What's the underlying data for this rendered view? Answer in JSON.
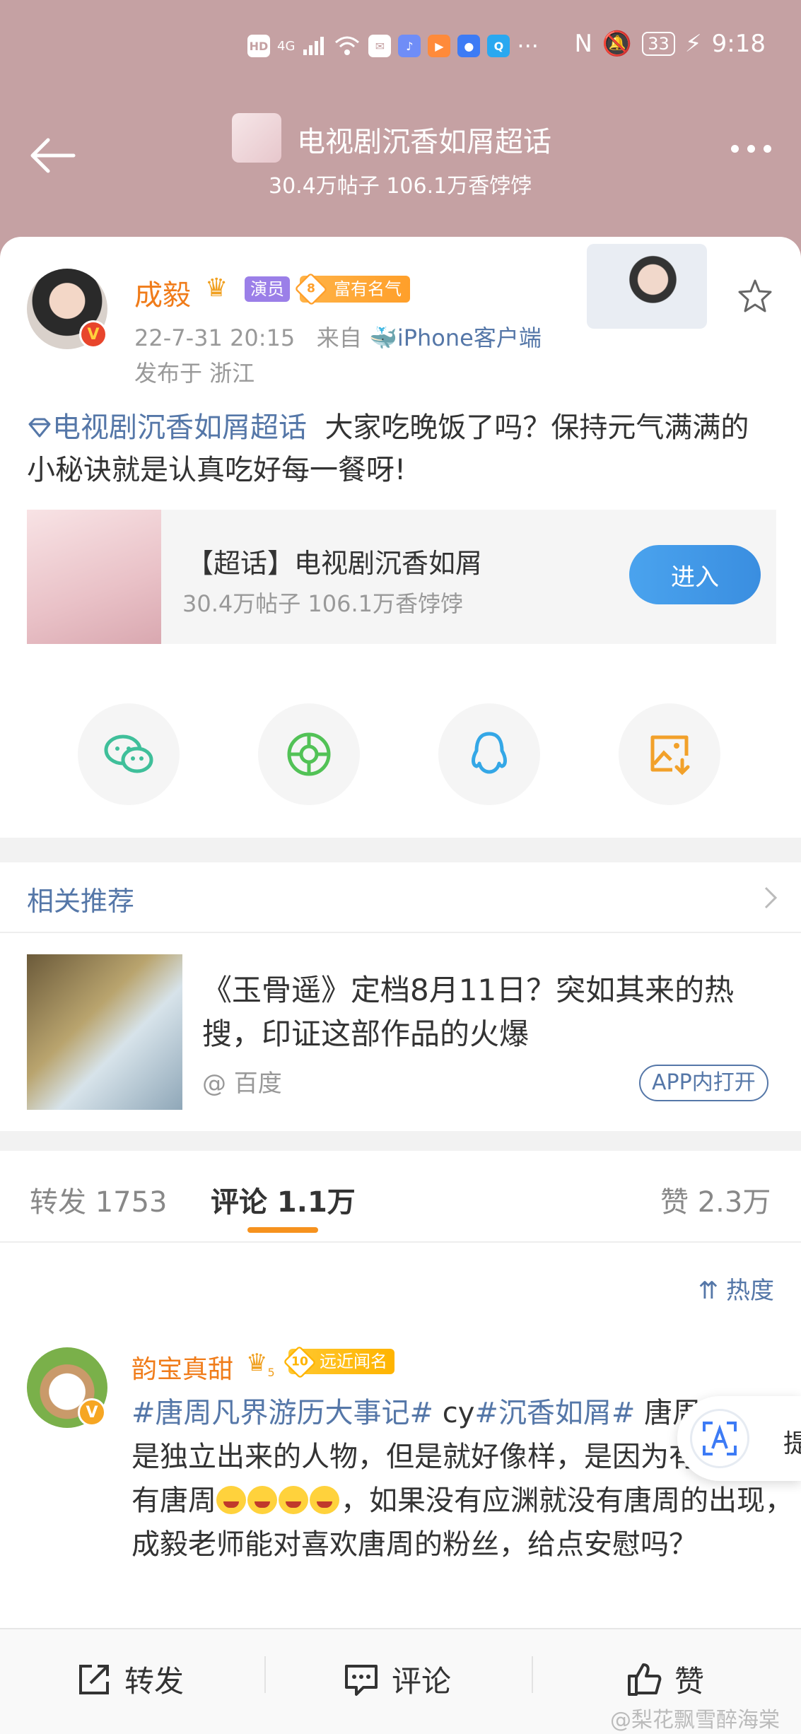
{
  "status_bar": {
    "hd": "HD",
    "net": "4G",
    "battery": "33",
    "time": "9:18"
  },
  "nav": {
    "title": "电视剧沉香如屑超话",
    "subtitle": "30.4万帖子 106.1万香饽饽"
  },
  "post": {
    "author": "成毅",
    "tag_actor": "演员",
    "rich_level": "8",
    "rich_label": "富有名气",
    "time": "22-7-31 20:15",
    "from_label": "来自",
    "source": "iPhone客户端",
    "location": "发布于 浙江",
    "topic": "电视剧沉香如屑超话",
    "text": "大家吃晚饭了吗？保持元气满满的小秘诀就是认真吃好每一餐呀!",
    "link_card": {
      "title": "【超话】电视剧沉香如屑",
      "subtitle": "30.4万帖子 106.1万香饽饽",
      "button": "进入"
    }
  },
  "share_icons": [
    "wechat-icon",
    "moments-icon",
    "qq-icon",
    "save-image-icon"
  ],
  "recommend": {
    "header": "相关推荐",
    "item": {
      "title": "《玉骨遥》定档8月11日？突如其来的热搜，印证这部作品的火爆",
      "source": "@ 百度",
      "app_button": "APP内打开"
    }
  },
  "tabs": {
    "repost": "转发 1753",
    "comment": "评论 1.1万",
    "like": "赞 2.3万",
    "sort": "热度"
  },
  "comment": {
    "author": "韵宝真甜",
    "crown_level": "5",
    "tag_level": "10",
    "tag_label": "远近闻名",
    "topic1": "#唐周凡界游历大事记#",
    "mid": " cy",
    "topic2": "#沉香如屑#",
    "text1": " 唐周虽然也是独立出来的人物，但是就好像",
    "text2": "样，是因为有应渊才有唐周",
    "text3": "，如果没有应渊就没有唐周的出现，成毅老师能对喜欢唐周的粉丝，给点安慰吗？"
  },
  "float_button": {
    "label": "提"
  },
  "bottom_bar": {
    "repost": "转发",
    "comment": "评论",
    "like": "赞"
  },
  "watermark": "@梨花飘雪醉海棠"
}
